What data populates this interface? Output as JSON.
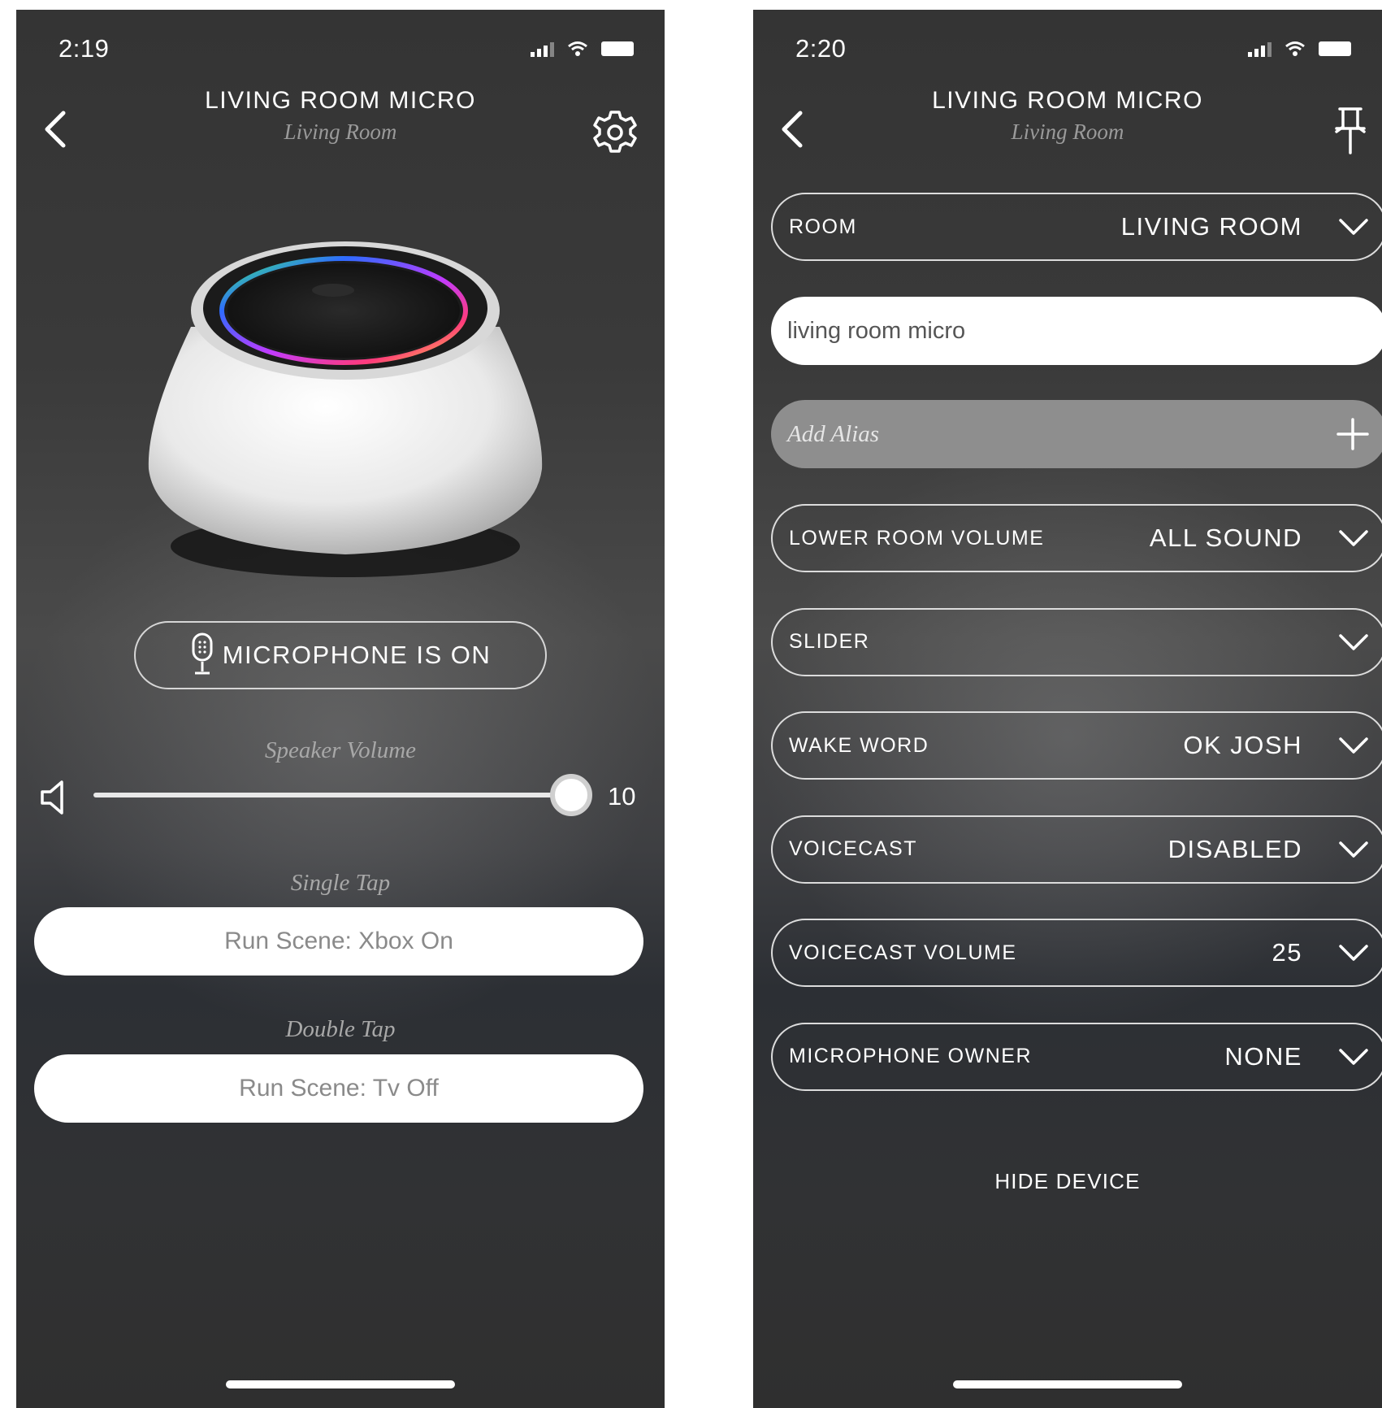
{
  "left_screen": {
    "status": {
      "time": "2:19"
    },
    "header": {
      "title": "LIVING ROOM MICRO",
      "subtitle": "Living Room"
    },
    "microphone_status": "MICROPHONE IS ON",
    "speaker_volume": {
      "label": "Speaker Volume",
      "value": "10",
      "level": 1.0
    },
    "single_tap": {
      "label": "Single Tap",
      "action": "Run Scene: Xbox On"
    },
    "double_tap": {
      "label": "Double Tap",
      "action": "Run Scene: Tv Off"
    }
  },
  "right_screen": {
    "status": {
      "time": "2:20"
    },
    "header": {
      "title": "LIVING ROOM MICRO",
      "subtitle": "Living Room"
    },
    "room": {
      "label": "ROOM",
      "value": "LIVING ROOM"
    },
    "device_name": {
      "value": "living room micro"
    },
    "alias": {
      "placeholder": "Add Alias"
    },
    "settings": [
      {
        "label": "LOWER ROOM VOLUME",
        "value": "ALL SOUND"
      },
      {
        "label": "SLIDER",
        "value": ""
      },
      {
        "label": "WAKE WORD",
        "value": "OK JOSH"
      },
      {
        "label": "VOICECAST",
        "value": "DISABLED"
      },
      {
        "label": "VOICECAST VOLUME",
        "value": "25"
      },
      {
        "label": "MICROPHONE OWNER",
        "value": "NONE"
      }
    ],
    "hide_device": "HIDE DEVICE"
  },
  "icons": {
    "back": "chevron-left-icon",
    "settings": "gear-icon",
    "pin": "pin-icon",
    "mic": "microphone-icon",
    "volume": "speaker-icon",
    "dropdown": "chevron-down-icon",
    "add": "plus-icon"
  }
}
